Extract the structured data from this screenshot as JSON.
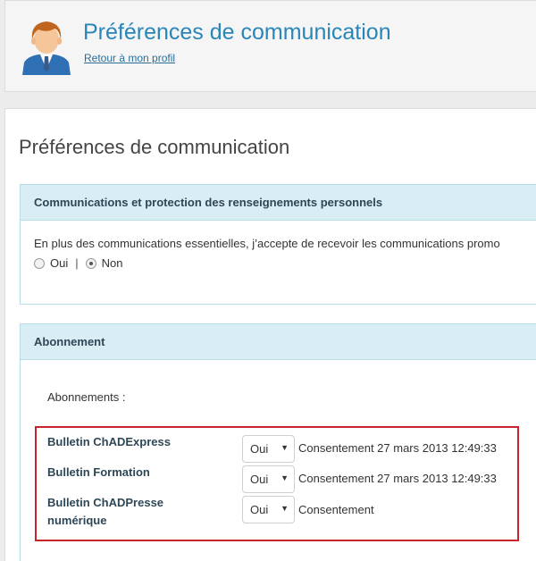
{
  "header": {
    "title": "Préférences de communication",
    "back_link": "Retour à mon profil"
  },
  "main": {
    "title": "Préférences de communication"
  },
  "privacy_panel": {
    "heading": "Communications et protection des renseignements personnels",
    "consent_text": "En plus des communications essentielles, j’accepte de recevoir les communications promo",
    "option_yes": "Oui",
    "separator": "|",
    "option_no": "Non",
    "selected": "Non"
  },
  "subscription_panel": {
    "heading": "Abonnement",
    "subscriptions_label": "Abonnements :",
    "rows": [
      {
        "name": "Bulletin ChADExpress",
        "value": "Oui",
        "consent": "Consentement 27 mars 2013 12:49:33"
      },
      {
        "name": "Bulletin Formation",
        "value": "Oui",
        "consent": "Consentement 27 mars 2013 12:49:33"
      },
      {
        "name": "Bulletin ChADPresse numérique",
        "value": "Oui",
        "consent": "Consentement"
      }
    ]
  },
  "icons": {
    "avatar": "user-avatar-icon",
    "select_caret": "caret-down-icon"
  },
  "colors": {
    "title_blue": "#2a85b8",
    "panel_header_bg": "#d9edf4",
    "panel_border": "#b6dce8",
    "highlight_red": "#c8242b"
  }
}
